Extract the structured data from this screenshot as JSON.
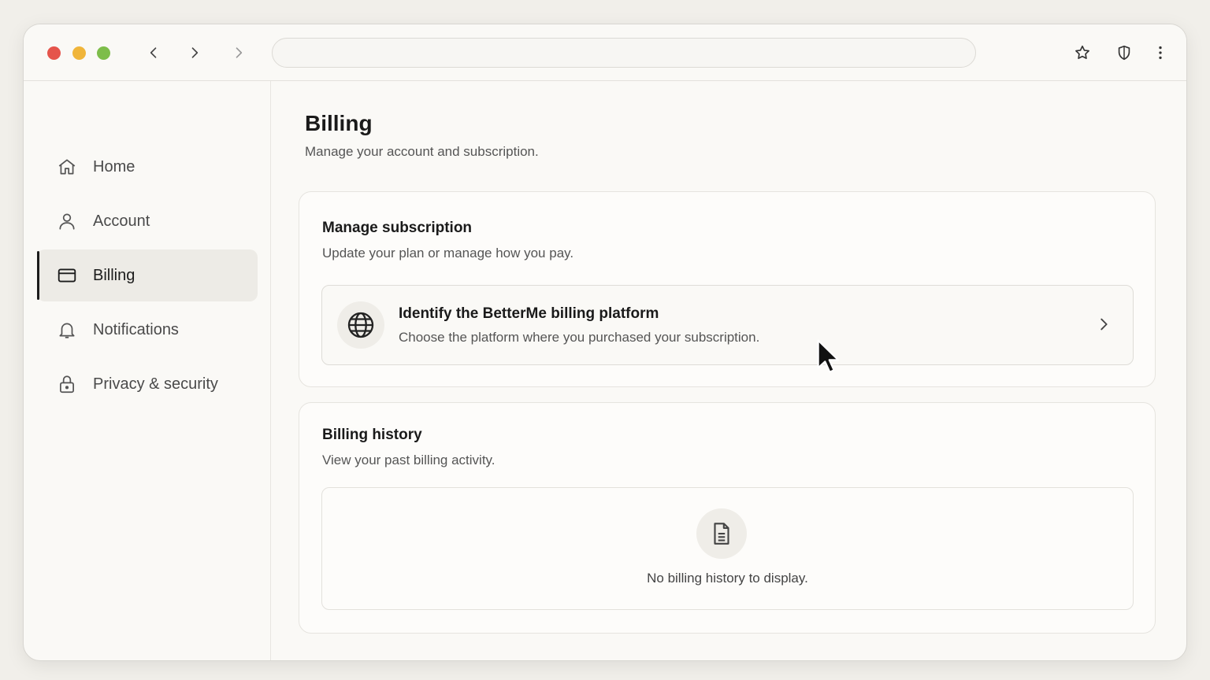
{
  "sidebar": {
    "items": [
      {
        "label": "Home",
        "icon": "home-icon"
      },
      {
        "label": "Account",
        "icon": "user-icon"
      },
      {
        "label": "Billing",
        "icon": "credit-card-icon",
        "active": true
      },
      {
        "label": "Notifications",
        "icon": "bell-icon"
      },
      {
        "label": "Privacy & security",
        "icon": "lock-icon"
      }
    ]
  },
  "main": {
    "title": "Billing",
    "subtitle": "Manage your account and subscription.",
    "subscription": {
      "title": "Manage subscription",
      "subtitle": "Update your plan or manage how you pay.",
      "row": {
        "title": "Identify the BetterMe billing platform",
        "subtitle": "Choose the platform where you purchased your subscription."
      }
    },
    "history": {
      "title": "Billing history",
      "subtitle": "View your past billing activity.",
      "empty_text": "No billing history to display."
    }
  },
  "colors": {
    "close": "#e5544b",
    "minimize": "#f0b53a",
    "maximize": "#7dbd4a"
  }
}
